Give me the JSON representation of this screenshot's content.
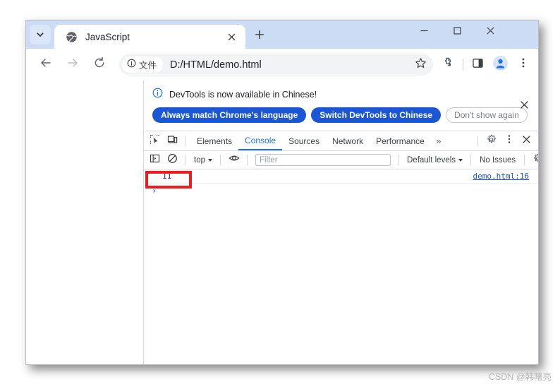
{
  "browser": {
    "tab": {
      "title": "JavaScript",
      "favicon_icon": "globe-icon",
      "close_icon": "close-icon"
    },
    "tab_search_icon": "chevron-down-icon",
    "new_tab_icon": "plus-icon",
    "window_controls": {
      "minimize_icon": "minimize-icon",
      "maximize_icon": "maximize-icon",
      "close_icon": "close-icon"
    },
    "toolbar": {
      "back_icon": "arrow-left-icon",
      "forward_icon": "arrow-right-icon",
      "reload_icon": "reload-icon",
      "site_info_icon": "info-circle-icon",
      "site_info_label": "文件",
      "url": "D:/HTML/demo.html",
      "bookmark_icon": "star-icon",
      "extensions_icon": "puzzle-piece-icon",
      "side_panel_icon": "side-panel-icon",
      "profile_icon": "person-avatar-icon",
      "menu_icon": "three-dots-vertical-icon"
    }
  },
  "devtools": {
    "notification": {
      "info_icon": "info-circle-icon",
      "message": "DevTools is now available in Chinese!",
      "buttons": [
        {
          "label": "Always match Chrome's language",
          "style": "primary"
        },
        {
          "label": "Switch DevTools to Chinese",
          "style": "primary"
        },
        {
          "label": "Don't show again",
          "style": "secondary"
        }
      ],
      "close_icon": "close-icon"
    },
    "tabbar": {
      "inspect_icon": "inspect-element-icon",
      "device_toolbar_icon": "device-toolbar-icon",
      "tabs": [
        {
          "label": "Elements",
          "active": false
        },
        {
          "label": "Console",
          "active": true
        },
        {
          "label": "Sources",
          "active": false
        },
        {
          "label": "Network",
          "active": false
        },
        {
          "label": "Performance",
          "active": false
        }
      ],
      "more_tabs_label": "»",
      "settings_icon": "gear-icon",
      "menu_icon": "three-dots-vertical-icon",
      "close_icon": "close-icon"
    },
    "console_toolbar": {
      "sidebar_toggle_icon": "console-sidebar-icon",
      "clear_console_icon": "clear-console-icon",
      "context_label": "top",
      "live_expression_icon": "eye-icon",
      "filter_placeholder": "Filter",
      "filter_value": "",
      "levels_label": "Default levels",
      "issues_label": "No Issues",
      "settings_icon": "gear-icon"
    },
    "console": {
      "output_value": "11",
      "source_link": "demo.html:16",
      "prompt_caret": "›"
    }
  },
  "annotation": {
    "highlight_color": "#ee1c1c"
  },
  "watermark": {
    "text": "CSDN @韩曙亮"
  }
}
